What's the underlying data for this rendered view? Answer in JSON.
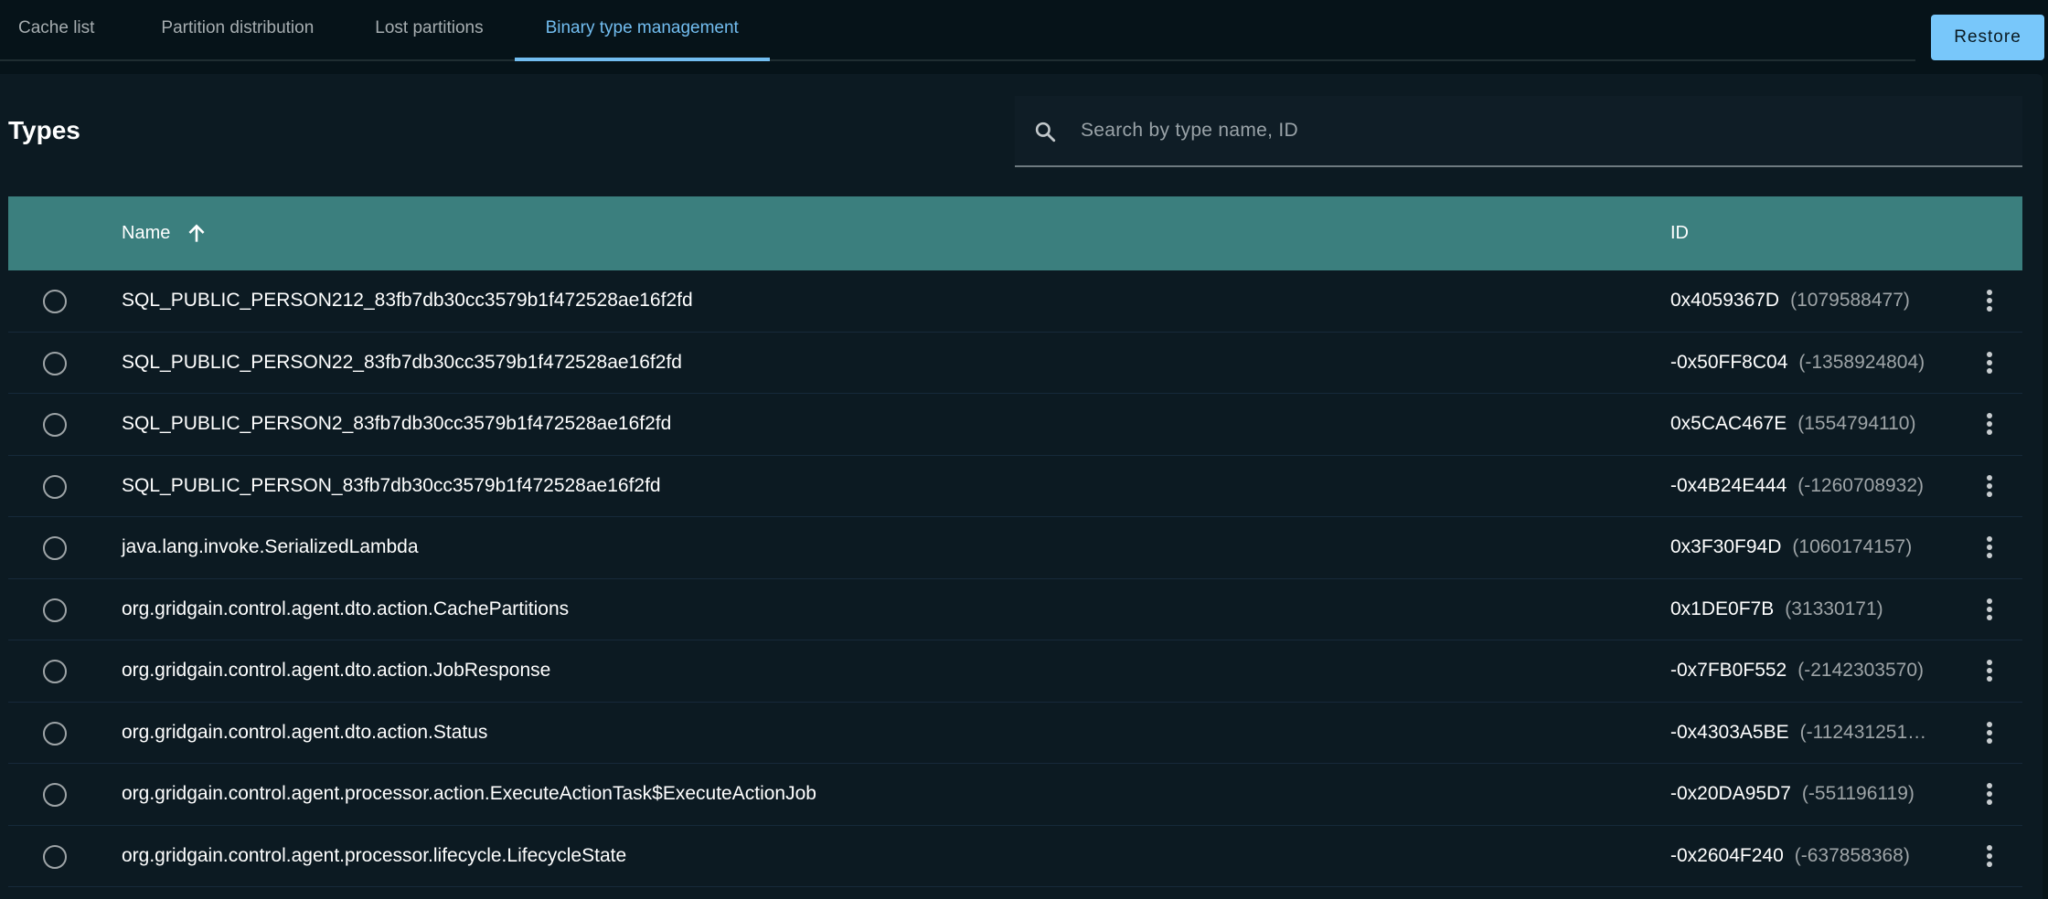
{
  "tabs": [
    {
      "label": "Cache list",
      "active": false
    },
    {
      "label": "Partition distribution",
      "active": false
    },
    {
      "label": "Lost partitions",
      "active": false
    },
    {
      "label": "Binary type management",
      "active": true
    }
  ],
  "toolbar": {
    "restore_label": "Restore"
  },
  "types": {
    "title": "Types",
    "search": {
      "placeholder": "Search by type name, ID",
      "value": "",
      "icon": "search-icon"
    },
    "table": {
      "columns": [
        {
          "label": "Name",
          "sort": "ascending",
          "sort_icon": "arrow-up-icon"
        },
        {
          "label": "ID"
        }
      ],
      "rows": [
        {
          "name": "SQL_PUBLIC_PERSON212_83fb7db30cc3579b1f472528ae16f2fd",
          "hex_id": "0x4059367D",
          "dec_id": "(1079588477)",
          "selected": false
        },
        {
          "name": "SQL_PUBLIC_PERSON22_83fb7db30cc3579b1f472528ae16f2fd",
          "hex_id": "-0x50FF8C04",
          "dec_id": "(-1358924804)",
          "selected": false
        },
        {
          "name": "SQL_PUBLIC_PERSON2_83fb7db30cc3579b1f472528ae16f2fd",
          "hex_id": "0x5CAC467E",
          "dec_id": "(1554794110)",
          "selected": false
        },
        {
          "name": "SQL_PUBLIC_PERSON_83fb7db30cc3579b1f472528ae16f2fd",
          "hex_id": "-0x4B24E444",
          "dec_id": "(-1260708932)",
          "selected": false
        },
        {
          "name": "java.lang.invoke.SerializedLambda",
          "hex_id": "0x3F30F94D",
          "dec_id": "(1060174157)",
          "selected": false
        },
        {
          "name": "org.gridgain.control.agent.dto.action.CachePartitions",
          "hex_id": "0x1DE0F7B",
          "dec_id": "(31330171)",
          "selected": false
        },
        {
          "name": "org.gridgain.control.agent.dto.action.JobResponse",
          "hex_id": "-0x7FB0F552",
          "dec_id": "(-2142303570)",
          "selected": false
        },
        {
          "name": "org.gridgain.control.agent.dto.action.Status",
          "hex_id": "-0x4303A5BE",
          "dec_id": "(-112431251…",
          "selected": false
        },
        {
          "name": "org.gridgain.control.agent.processor.action.ExecuteActionTask$ExecuteActionJob",
          "hex_id": "-0x20DA95D7",
          "dec_id": "(-551196119)",
          "selected": false
        },
        {
          "name": "org.gridgain.control.agent.processor.lifecycle.LifecycleState",
          "hex_id": "-0x2604F240",
          "dec_id": "(-637858368)",
          "selected": false
        }
      ]
    }
  },
  "colors": {
    "accent": "#72bdf0",
    "button_bg": "#78c7fa",
    "table_header_bg": "#3b7f7e",
    "panel_bg": "#0c1a22",
    "page_bg": "#061319"
  }
}
